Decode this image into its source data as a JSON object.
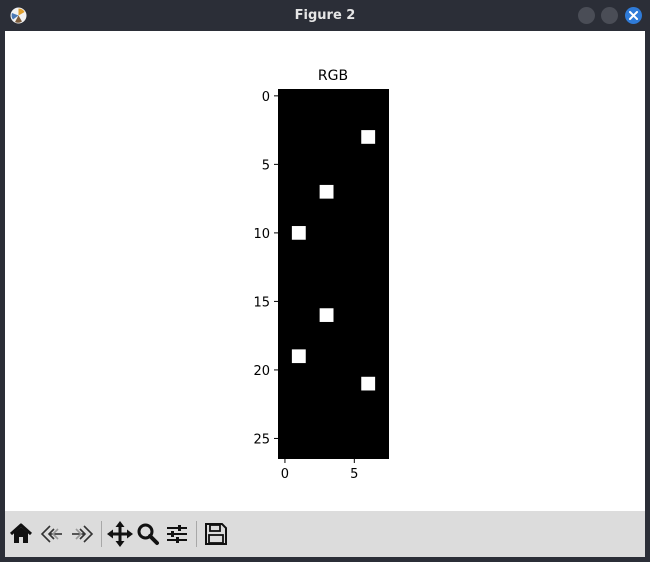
{
  "window": {
    "title": "Figure 2"
  },
  "toolbar": {
    "buttons": [
      "home-icon",
      "back-icon",
      "forward-icon",
      "pan-icon",
      "zoom-icon",
      "configure-icon",
      "save-icon"
    ]
  },
  "chart_data": {
    "type": "heatmap",
    "title": "RGB",
    "image_shape": [
      27,
      8
    ],
    "colormap": "black background with white pixels",
    "white_pixels": [
      {
        "row": 3,
        "col": 6
      },
      {
        "row": 7,
        "col": 3
      },
      {
        "row": 10,
        "col": 1
      },
      {
        "row": 16,
        "col": 3
      },
      {
        "row": 19,
        "col": 1
      },
      {
        "row": 21,
        "col": 6
      }
    ],
    "xlim": [
      -0.5,
      7.5
    ],
    "ylim": [
      26.5,
      -0.5
    ],
    "xticks": [
      "0",
      "5"
    ],
    "yticks": [
      "0",
      "5",
      "10",
      "15",
      "20",
      "25"
    ],
    "xlabel": "",
    "ylabel": ""
  }
}
